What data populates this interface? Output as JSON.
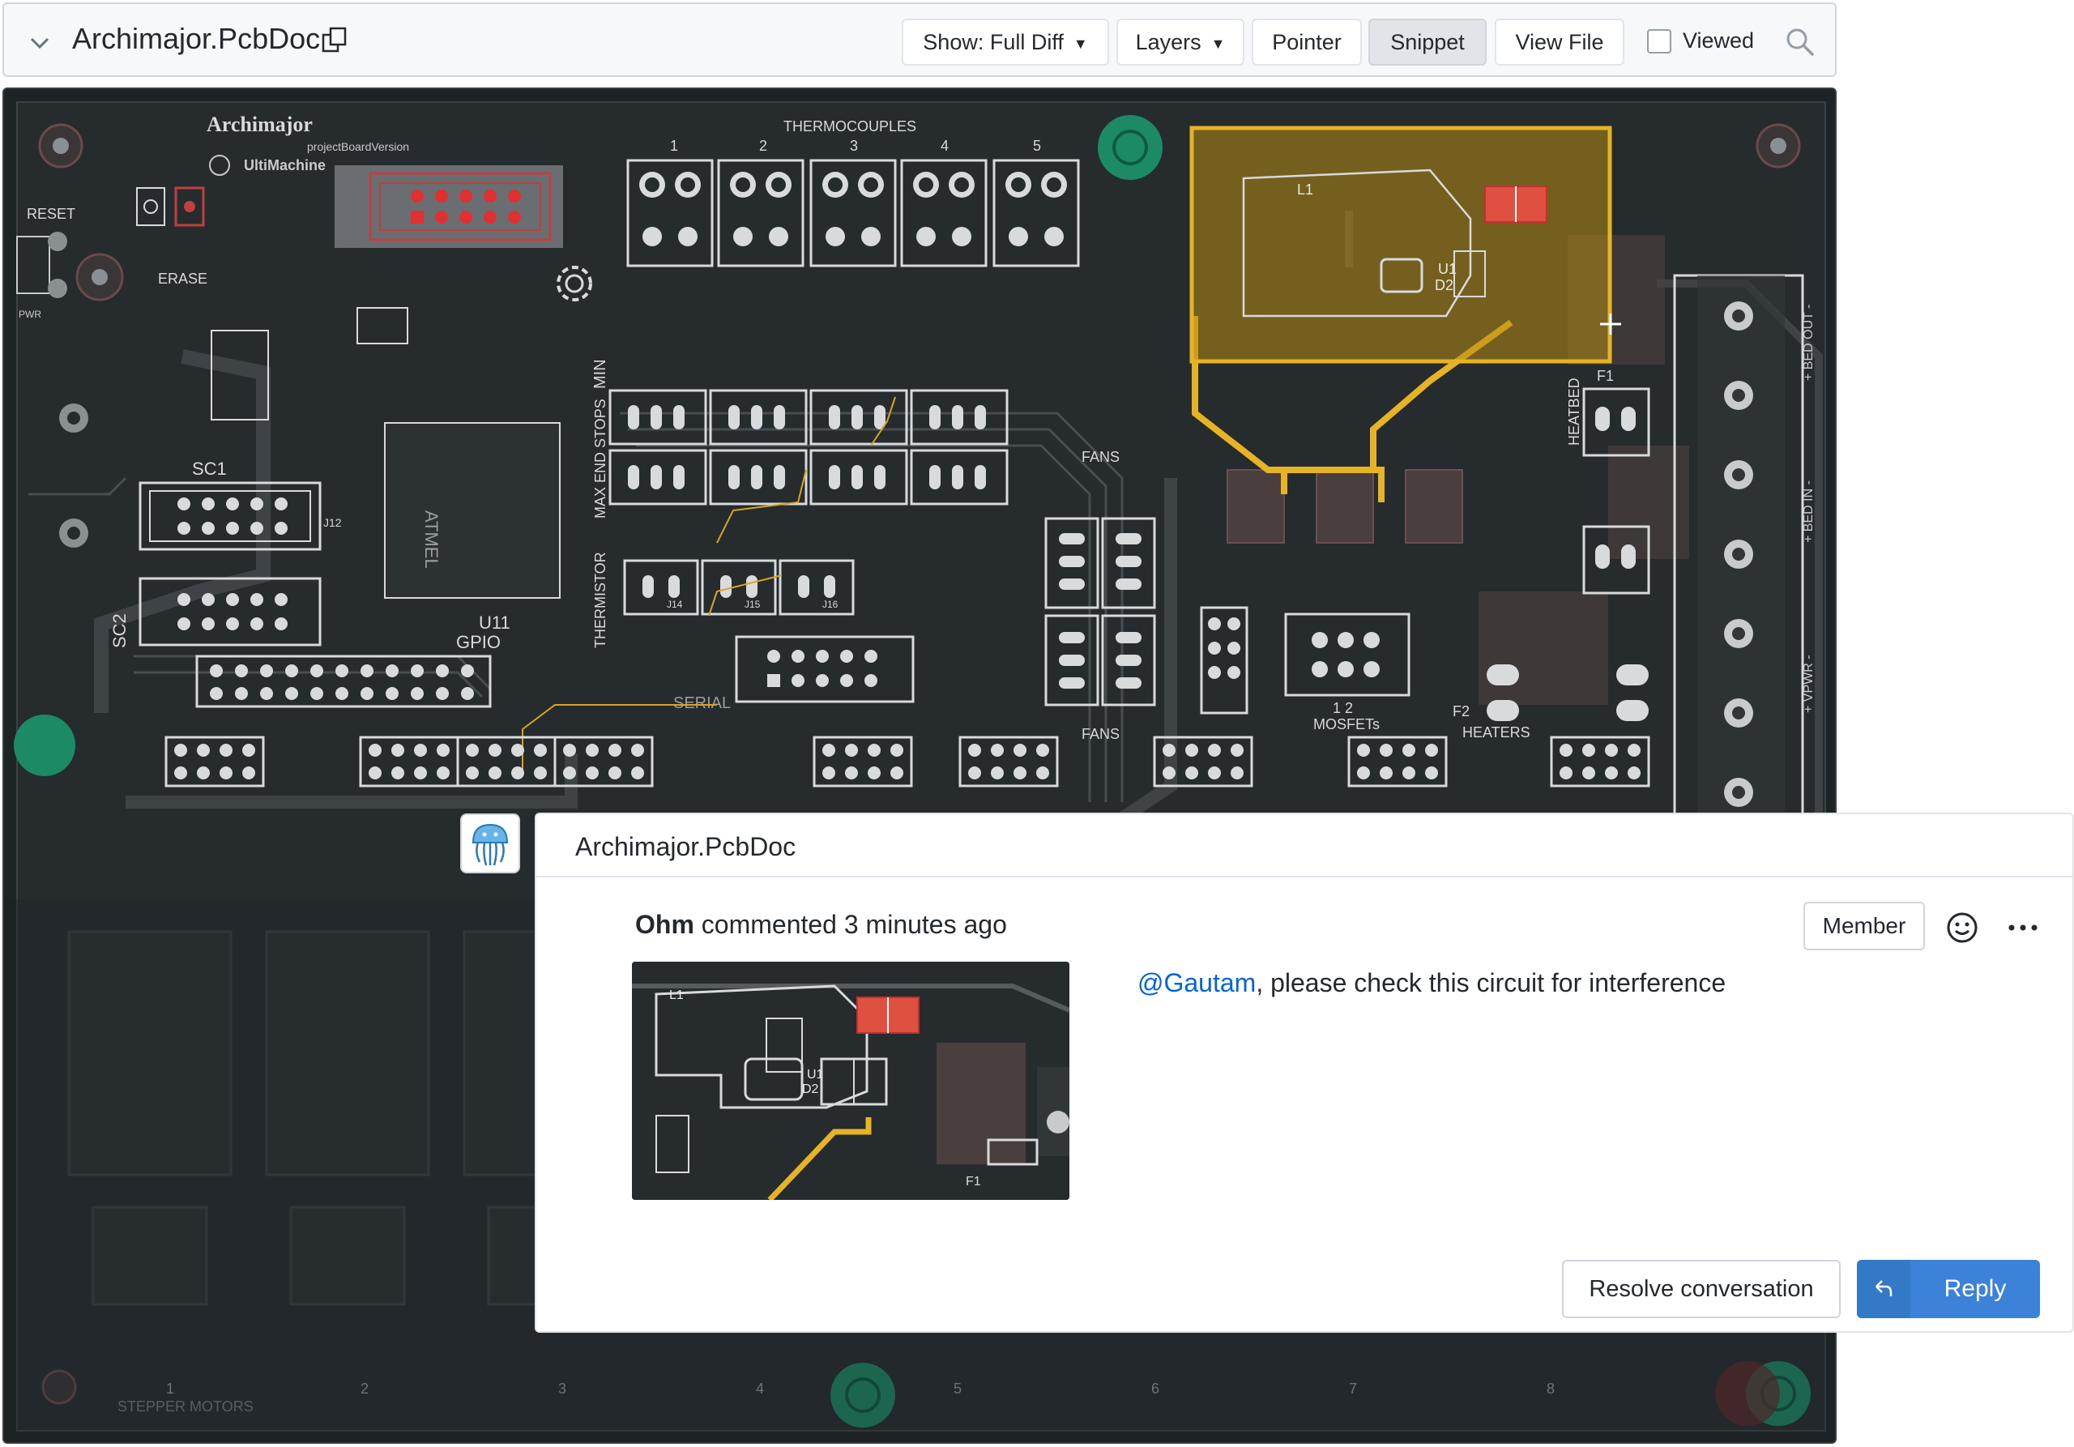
{
  "file_header": {
    "file_name": "Archimajor.PcbDoc",
    "show_label": "Show: Full Diff",
    "layers_label": "Layers",
    "pointer_label": "Pointer",
    "snippet_label": "Snippet",
    "view_file_label": "View File",
    "viewed_label": "Viewed"
  },
  "pcb": {
    "logo": "Archimajor",
    "logo_sub": "projectBoardVersion",
    "brand": "UltiMachine",
    "labels": {
      "reset": "RESET",
      "erase": "ERASE",
      "pwr": "PWR",
      "thermocouples": "THERMOCOUPLES",
      "tc1": "1",
      "tc2": "2",
      "tc3": "3",
      "tc4": "4",
      "tc5": "5",
      "sc1": "SC1",
      "sc2": "SC2",
      "j12": "J12",
      "u11": "U11",
      "gpio": "GPIO",
      "min": "MIN",
      "max_end_stops": "MAX END STOPS",
      "thermistor": "THERMISTOR",
      "j14": "J14",
      "j15": "J15",
      "j16": "J16",
      "serial": "SERIAL",
      "fans": "FANS",
      "fans2": "FANS",
      "mosfets": "MOSFETs",
      "mosfets_num": "1 2",
      "heaters": "HEATERS",
      "heatbed": "HEATBED",
      "bed_out": "+ BED OUT -",
      "bed_in": "+ BED IN -",
      "vpwr": "+ VPWR -",
      "l1": "L1",
      "d2": "D2",
      "u1": "U1",
      "f1": "F1",
      "f2": "F2",
      "stepper_motors": "STEPPER MOTORS",
      "st1": "1",
      "st2": "2",
      "st3": "3",
      "st4": "4",
      "st5": "5",
      "st6": "6",
      "st7": "7",
      "st8": "8"
    }
  },
  "comment": {
    "panel_file": "Archimajor.PcbDoc",
    "author": "Ohm",
    "action": "commented",
    "time": "3 minutes ago",
    "badge": "Member",
    "mention": "@Gautam",
    "body": ", please check this circuit for interference",
    "snippet_labels": {
      "l1": "L1",
      "d2": "D2",
      "u1": "U1",
      "f1": "F1"
    },
    "resolve_label": "Resolve conversation",
    "reply_label": "Reply"
  },
  "colors": {
    "accent_blue": "#3b82d8",
    "link_blue": "#0366d6",
    "selection_yellow": "#e6b325",
    "pcb_bg": "#1e2326",
    "pad_green": "#1d8a66"
  },
  "icons": [
    "chevron-down-icon",
    "copy-icon",
    "caret-down-icon",
    "search-icon",
    "emoji-icon",
    "more-icon",
    "reply-arrow-icon",
    "jellyfish-avatar-icon"
  ]
}
